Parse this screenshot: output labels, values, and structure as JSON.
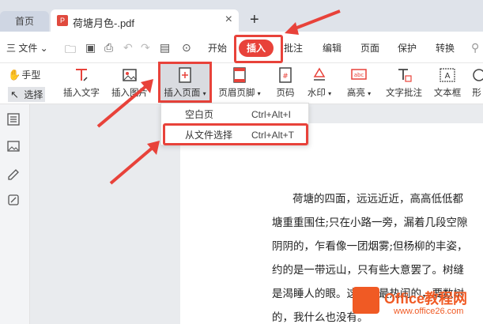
{
  "tabs": {
    "home": "首页",
    "document": "荷塘月色-.pdf",
    "close": "×",
    "new": "+"
  },
  "menu": {
    "file": "三 文件 ⌄",
    "items": [
      "开始",
      "插入",
      "批注",
      "编辑",
      "页面",
      "保护",
      "转换"
    ],
    "active": "插入"
  },
  "ribbon": {
    "hand": "手型",
    "select": "选择",
    "tools": [
      "插入文字",
      "插入图片",
      "插入页面",
      "页眉页脚",
      "页码",
      "水印",
      "高亮",
      "文字批注",
      "文本框",
      "形"
    ]
  },
  "dropdown": {
    "items": [
      {
        "label": "空白页",
        "shortcut": "Ctrl+Alt+I"
      },
      {
        "label": "从文件选择",
        "shortcut": "Ctrl+Alt+T"
      }
    ]
  },
  "document": {
    "lines": [
      "荷塘的四面，远远近近，高高低低都",
      "塘重重围住;只在小路一旁，漏着几段空隙",
      "阴阴的，乍看像一团烟雾;但杨柳的丰姿，",
      "约的是一带远山，只有些大意罢了。树缝",
      "是渴睡人的眼。这时候最热闹的，要数树",
      "的，我什么也没有。"
    ]
  },
  "watermark": {
    "brand": "Office教程网",
    "site": "www.office26.com"
  },
  "colors": {
    "accent": "#e8423a",
    "pdf": "#e04a3e",
    "brand": "#f05a24"
  }
}
